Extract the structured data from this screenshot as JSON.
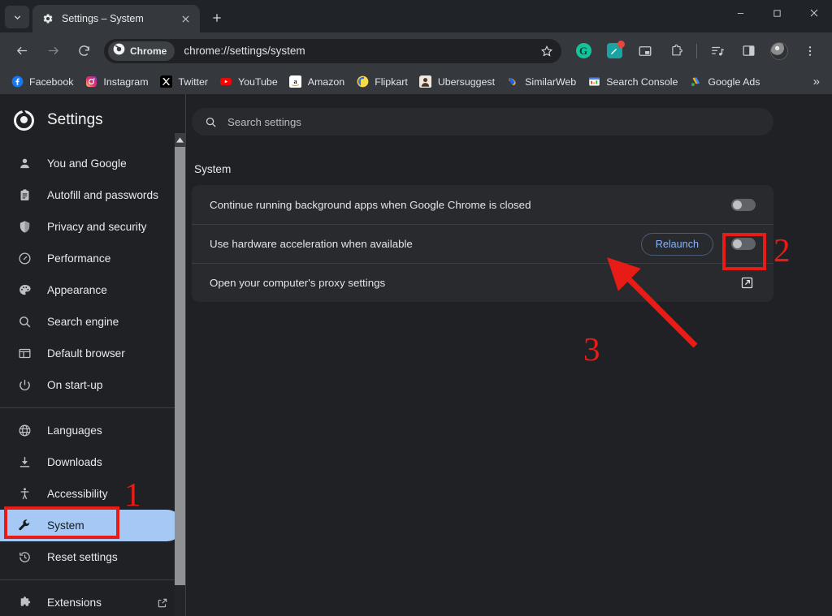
{
  "window": {
    "tab_list_icon": "chevron-down-icon",
    "tab": {
      "title": "Settings – System",
      "favicon": "gear-icon",
      "close": "×"
    },
    "new_tab_label": "+",
    "controls": {
      "minimize": "–",
      "maximize": "□",
      "close": "×"
    }
  },
  "toolbar": {
    "back": "←",
    "forward": "→",
    "reload": "⟳",
    "chip_label": "Chrome",
    "url": "chrome://settings/system",
    "bookmark_star": "☆",
    "extensions": [
      {
        "name": "grammarly-extension-icon",
        "glyph": "G"
      },
      {
        "name": "extension-icon-badged",
        "glyph": ""
      },
      {
        "name": "picture-in-picture-icon",
        "glyph": ""
      },
      {
        "name": "extensions-puzzle-icon",
        "glyph": ""
      }
    ],
    "reading_list": "reading-list-icon",
    "side_panel": "side-panel-icon",
    "profile": "avatar",
    "menu": "three-dot-menu-icon"
  },
  "bookmarks": {
    "items": [
      {
        "label": "Facebook",
        "icon": "facebook-icon"
      },
      {
        "label": "Instagram",
        "icon": "instagram-icon"
      },
      {
        "label": "Twitter",
        "icon": "twitter-x-icon"
      },
      {
        "label": "YouTube",
        "icon": "youtube-icon"
      },
      {
        "label": "Amazon",
        "icon": "amazon-icon"
      },
      {
        "label": "Flipkart",
        "icon": "flipkart-icon"
      },
      {
        "label": "Ubersuggest",
        "icon": "ubersuggest-icon"
      },
      {
        "label": "SimilarWeb",
        "icon": "similarweb-icon"
      },
      {
        "label": "Search Console",
        "icon": "search-console-icon"
      },
      {
        "label": "Google Ads",
        "icon": "google-ads-icon"
      }
    ],
    "overflow": "»"
  },
  "sidebar": {
    "title": "Settings",
    "logo": "chrome-logo-icon",
    "items": [
      {
        "label": "You and Google",
        "icon": "person-icon",
        "selected": false
      },
      {
        "label": "Autofill and passwords",
        "icon": "clipboard-icon",
        "selected": false
      },
      {
        "label": "Privacy and security",
        "icon": "shield-icon",
        "selected": false
      },
      {
        "label": "Performance",
        "icon": "speedometer-icon",
        "selected": false
      },
      {
        "label": "Appearance",
        "icon": "palette-icon",
        "selected": false
      },
      {
        "label": "Search engine",
        "icon": "search-icon",
        "selected": false
      },
      {
        "label": "Default browser",
        "icon": "browser-window-icon",
        "selected": false
      },
      {
        "label": "On start-up",
        "icon": "power-icon",
        "selected": false
      },
      {
        "label": "Languages",
        "icon": "globe-icon",
        "selected": false
      },
      {
        "label": "Downloads",
        "icon": "download-icon",
        "selected": false
      },
      {
        "label": "Accessibility",
        "icon": "accessibility-icon",
        "selected": false
      },
      {
        "label": "System",
        "icon": "wrench-icon",
        "selected": true
      },
      {
        "label": "Reset settings",
        "icon": "history-restore-icon",
        "selected": false
      },
      {
        "label": "Extensions",
        "icon": "puzzle-icon",
        "selected": false,
        "external": true
      }
    ]
  },
  "main": {
    "search": {
      "placeholder": "Search settings",
      "icon": "search-icon"
    },
    "section_title": "System",
    "rows": [
      {
        "label": "Continue running background apps when Google Chrome is closed",
        "control": "toggle",
        "toggle_on": false
      },
      {
        "label": "Use hardware acceleration when available",
        "control": "toggle",
        "toggle_on": false,
        "button_label": "Relaunch"
      },
      {
        "label": "Open your computer's proxy settings",
        "control": "external-link"
      }
    ]
  },
  "annotations": {
    "accent_color": "#e81c16",
    "step_1": "1",
    "step_2": "2",
    "step_3": "3"
  },
  "colors": {
    "page_bg": "#202124",
    "card_bg": "#292a2d",
    "toolbar_bg": "#35393e",
    "selected_nav": "#a5c8f5",
    "link_blue": "#8ab4f8",
    "annotation_red": "#e81c16"
  }
}
